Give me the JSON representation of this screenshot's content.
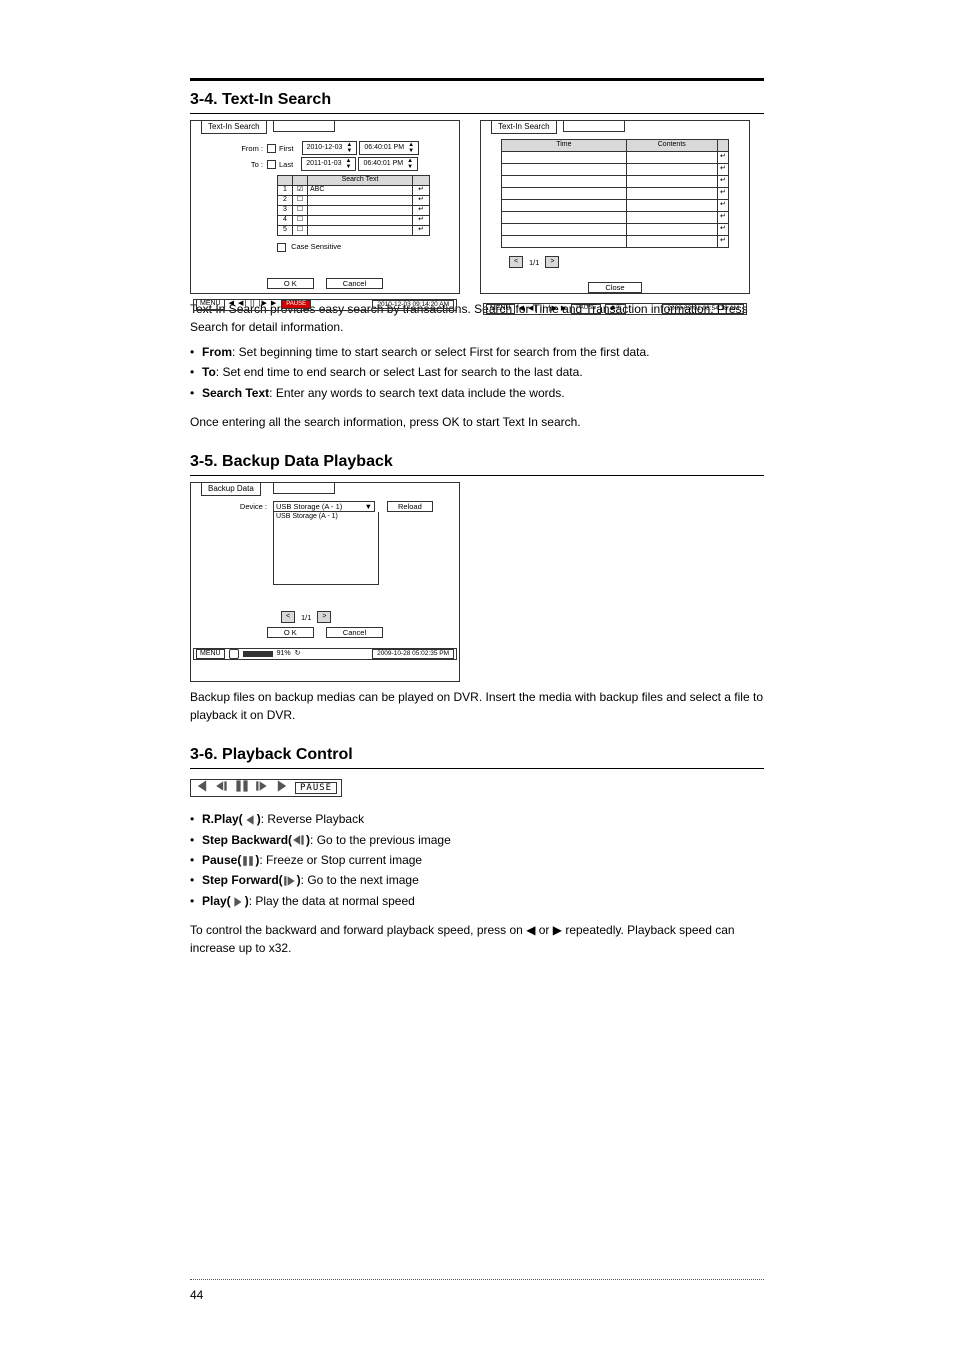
{
  "sections": {
    "s34": {
      "title": "3-4. Text-In Search"
    },
    "s35": {
      "title": "3-5. Backup Data Playback"
    },
    "s36": {
      "title": "3-6. Playback Control"
    }
  },
  "fig1": {
    "tab": "Text-In Search",
    "from_label": "From :",
    "first_label": "First",
    "to_label": "To :",
    "last_label": "Last",
    "from_date": "2010-12-03",
    "from_time": "06:40:01 PM",
    "to_date": "2011-01-03",
    "to_time": "06:40:01 PM",
    "search_header": "Search Text",
    "row1_text": "ABC",
    "enter": "↵",
    "case_label": "Case Sensitive",
    "ok": "O K",
    "cancel": "Cancel",
    "menu": "MENU",
    "controls": "◀ ◀| || |▶ ▶",
    "pause": "PAUSE",
    "stamp": "2010-12-03 09:14:20 AM"
  },
  "fig2": {
    "tab": "Text-In Search",
    "time": "Time",
    "contents": "Contents",
    "enter": "↵",
    "page": "1/1",
    "close": "Close",
    "menu": "MENU",
    "controls": "◀ ◀| || |▶ ▶",
    "pause": "PAUSE",
    "exit": "⏏①",
    "stamp": "2009-03-01 08:54:18 AM"
  },
  "fig3": {
    "tab": "Backup Data",
    "device_label": "Device :",
    "device_sel": "USB Storage (A - 1)",
    "device_opt": "USB Storage (A - 1)",
    "reload": "Reload",
    "page": "1/1",
    "ok": "O K",
    "cancel": "Cancel",
    "menu": "MENU",
    "pct": "91%",
    "stamp": "2009-10-28 05:02:35 PM"
  },
  "text34": {
    "p1": "Text In Search provides easy search by transactions. Search for Time and Transaction information. Press Search for detail information.",
    "b1_k": "From",
    "b1_v": ": Set beginning time to start search or select First for search from the first data.",
    "b2_k": "To",
    "b2_v": ": Set end time to end search or select Last for search to the last data.",
    "b3_k": "Search Text",
    "b3_v": ": Enter any words to search text data include the words.",
    "p2": "Once entering all the search information, press OK to start Text In search."
  },
  "text35": {
    "p1": "Backup files on backup medias can be played on DVR. Insert the media with backup files and select a file to playback it on DVR."
  },
  "playbar": {
    "pause": "PAUSE"
  },
  "text36": {
    "b1_k": "R.Play(",
    "b1_v": ")",
    "b1_d": ": Reverse Playback",
    "b2_k": "Step Backward(",
    "b2_v": ")",
    "b2_d": ": Go to the previous image",
    "b3_k": "Pause(",
    "b3_v": ")",
    "b3_d": ": Freeze or Stop current image",
    "b4_k": "Step Forward(",
    "b4_v": ")",
    "b4_d": ": Go to the next image",
    "b5_k": "Play(",
    "b5_v": ")",
    "b5_d": ": Play the data at normal speed",
    "p1a": "To control the backward and forward playback speed, press on  ",
    "or": "  or  ",
    "p1b": "  repeatedly. Playback speed can increase up to x32."
  },
  "page_number": "44"
}
